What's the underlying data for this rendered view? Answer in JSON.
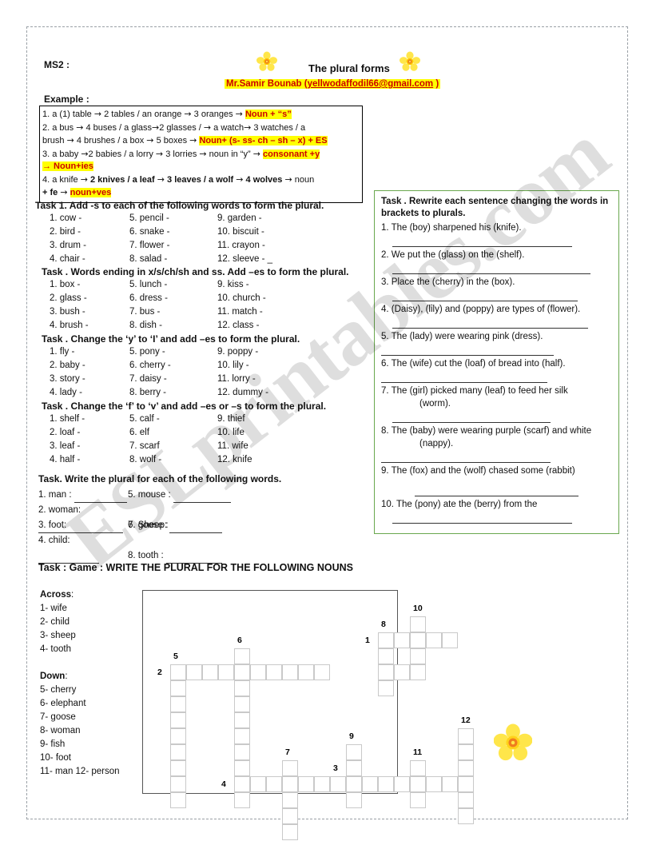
{
  "header": {
    "ms2": "MS2 :",
    "title": "The plural forms",
    "email_line": "Mr.Samir Bounab (yellwodaffodil66@gmail.com )",
    "email_prefix": "Mr.Samir Bounab (",
    "email_link": "yellwodaffodil66@gmail.com",
    "email_suffix": " )",
    "example_label": "Example :",
    "flower_left_icon": "daffodil-flower-icon",
    "flower_right_icon": "daffodil-flower-icon",
    "highlight_color": "#ffff00",
    "email_color": "#cc0000"
  },
  "example_box": {
    "lines": [
      {
        "parts": [
          {
            "t": "1.  a (1) table ",
            "s": "plain"
          },
          {
            "t": "→",
            "s": "arrow"
          },
          {
            "t": " 2 tables  / an orange ",
            "s": "plain"
          },
          {
            "t": "→",
            "s": "arrow"
          },
          {
            "t": " 3 oranges ",
            "s": "plain"
          },
          {
            "t": "→",
            "s": "arrow"
          },
          {
            "t": " ",
            "s": "plain"
          },
          {
            "t": "Noun + “s”",
            "s": "hl"
          }
        ]
      },
      {
        "parts": [
          {
            "t": "2. a bus ",
            "s": "plain"
          },
          {
            "t": "→",
            "s": "arrow"
          },
          {
            "t": " 4 buses / a glass",
            "s": "plain"
          },
          {
            "t": "→",
            "s": "arrow"
          },
          {
            "t": "2 glasses /  ",
            "s": "plain"
          },
          {
            "t": "→",
            "s": "arrow"
          },
          {
            "t": " a  watch",
            "s": "plain"
          },
          {
            "t": "→",
            "s": "arrow"
          },
          {
            "t": " 3 watches / a",
            "s": "plain"
          }
        ]
      },
      {
        "parts": [
          {
            "t": "brush ",
            "s": "plain"
          },
          {
            "t": "→",
            "s": "arrow"
          },
          {
            "t": " 4 brushes /  a box ",
            "s": "plain"
          },
          {
            "t": "→",
            "s": "arrow"
          },
          {
            "t": " 5 boxes ",
            "s": "plain"
          },
          {
            "t": "→",
            "s": "arrow"
          },
          {
            "t": " ",
            "s": "plain"
          },
          {
            "t": "Noun+ (s- ss- ch – sh – x) + ES",
            "s": "hl"
          }
        ]
      },
      {
        "parts": [
          {
            "t": "3. a baby ",
            "s": "plain"
          },
          {
            "t": "→",
            "s": "arrow"
          },
          {
            "t": "2 babies / a lorry ",
            "s": "plain"
          },
          {
            "t": "→",
            "s": "arrow"
          },
          {
            "t": " 3 lorries ",
            "s": "plain"
          },
          {
            "t": "→",
            "s": "arrow"
          },
          {
            "t": " noun in “y” ",
            "s": "plain"
          },
          {
            "t": "→",
            "s": "arrow"
          },
          {
            "t": " ",
            "s": "plain"
          },
          {
            "t": "consonant +y",
            "s": "hl"
          }
        ]
      },
      {
        "parts": [
          {
            "t": "→ Noun+ies",
            "s": "hl"
          }
        ]
      },
      {
        "parts": [
          {
            "t": "4. a knife ",
            "s": "plain"
          },
          {
            "t": "→",
            "s": "arrow"
          },
          {
            "t": "  2 knives / a leaf ",
            "s": "bold"
          },
          {
            "t": "→",
            "s": "arrow"
          },
          {
            "t": " 3 leaves / a wolf ",
            "s": "bold"
          },
          {
            "t": "→",
            "s": "arrow"
          },
          {
            "t": " 4 wolves ",
            "s": "bold"
          },
          {
            "t": "→",
            "s": "arrow"
          },
          {
            "t": "  noun",
            "s": "plain"
          }
        ]
      },
      {
        "parts": [
          {
            "t": "+ fe ",
            "s": "bold"
          },
          {
            "t": "→",
            "s": "arrow"
          },
          {
            "t": " ",
            "s": "plain"
          },
          {
            "t": "noun+ves",
            "s": "hl"
          }
        ]
      }
    ]
  },
  "tasks": [
    {
      "id": "task1",
      "heading": "Task 1.  Add  -s  to each of the following words to form the plural.",
      "rows": [
        [
          "1.  cow -",
          "5.  pencil -",
          "9.  garden -"
        ],
        [
          "2.  bird -",
          "6.  snake -",
          "10.  biscuit -"
        ],
        [
          "3.  drum -",
          "7.  flower -",
          "11.  crayon -"
        ],
        [
          "4.  chair -",
          "8.  salad -",
          "12.  sleeve -  _"
        ]
      ]
    },
    {
      "id": "task2",
      "heading": "Task .  Words ending in x/s/ch/sh and ss. Add –es to form the plural.",
      "rows": [
        [
          "1.  box -",
          "5.  lunch -",
          "9.  kiss      -"
        ],
        [
          "2.  glass -",
          "6.  dress -",
          "10.  church -"
        ],
        [
          "3.  bush -",
          "7.  bus -",
          "11.  match -"
        ],
        [
          "4.  brush -",
          "8.  dish  -",
          "12.  class   -"
        ]
      ]
    },
    {
      "id": "task3",
      "heading": "Task .  Change the ‘y’ to ‘I’ and add –es to form the plural.",
      "rows": [
        [
          "1.  fly   -",
          "5.  pony -",
          "9.  poppy -"
        ],
        [
          "2.  baby -",
          "6.  cherry -",
          "10.  lily        -"
        ],
        [
          "3.  story -",
          "7.  daisy  -",
          "11.  lorry   -"
        ],
        [
          "4.  lady  -",
          "8.  berry -",
          "12.  dummy -"
        ]
      ]
    },
    {
      "id": "task4",
      "heading": "Task .  Change the ‘f’ to ‘v’ and add –es or –s to form the plural.",
      "rows": [
        [
          "1.  shelf -",
          "5.  calf -",
          "9.  thief"
        ],
        [
          "2.  loaf  -",
          "6.  elf",
          "10.  life"
        ],
        [
          "3.  leaf   -",
          "7.  scarf",
          "11.  wife"
        ],
        [
          "4.  half   -",
          "8.  wolf -",
          "12.  knife"
        ]
      ]
    }
  ],
  "task_write_plural": {
    "heading": "Task. Write the plural for each of the following words.",
    "rows": [
      [
        "1.  man :",
        "5. mouse :"
      ],
      [
        "2.  woman:",
        "6.  goose :"
      ],
      [
        "3.  foot:",
        "7.  Sheep:"
      ],
      [
        "4.  child:",
        "8.  tooth :"
      ]
    ]
  },
  "green_box": {
    "heading": "Task . Rewrite each sentence changing the words in brackets to plurals.",
    "sentences": [
      {
        "n": "1.",
        "text": "The (boy) sharpened his (knife).",
        "indent": ""
      },
      {
        "n": "2.",
        "text": "We put the (glass) on the (shelf).",
        "indent": ""
      },
      {
        "n": "3.",
        "text": "Place the (cherry) in the (box).",
        "indent": ""
      },
      {
        "n": "4.",
        "text": "(Daisy), (lily) and (poppy) are types of (flower).",
        "indent": ""
      },
      {
        "n": "5.",
        "text": "The (lady) were wearing pink (dress).",
        "indent": ""
      },
      {
        "n": "6.",
        "text": "The (wife) cut the (loaf) of bread into (half).",
        "indent": ""
      },
      {
        "n": "7.",
        "text": "The (girl) picked many (leaf) to feed her silk",
        "indent": "(worm)."
      },
      {
        "n": "8.",
        "text": "The (baby) were wearing purple (scarf) and white",
        "indent": "(nappy)."
      },
      {
        "n": "9.",
        "text": "The (fox) and the (wolf) chased some (rabbit)",
        "indent": ""
      },
      {
        "n": "10.",
        "text": "The (pony) ate the (berry) from the",
        "indent": ""
      }
    ],
    "border_color": "#6aa84f"
  },
  "game": {
    "heading": "Task :  Game : WRITE THE PLURAL FOR THE FOLLOWING NOUNS",
    "across_title": "Across",
    "across_colon": ":",
    "across": [
      "1- wife",
      "2- child",
      "3- sheep",
      "4- tooth"
    ],
    "down_title": "Down",
    "down_colon": ":",
    "down": [
      "5- cherry",
      "6- elephant",
      "7- goose",
      "8- woman",
      "9- fish",
      "10- foot",
      "11- man    12- person"
    ],
    "crossword": {
      "cell_size": 20,
      "cells": [
        [
          16,
          1
        ],
        [
          16,
          2
        ],
        [
          16,
          3
        ],
        [
          14,
          2
        ],
        [
          15,
          2
        ],
        [
          16,
          2
        ],
        [
          17,
          2
        ],
        [
          18,
          2
        ],
        [
          14,
          3
        ],
        [
          14,
          4
        ],
        [
          16,
          3
        ],
        [
          16,
          4
        ],
        [
          5,
          3
        ],
        [
          1,
          4
        ],
        [
          2,
          4
        ],
        [
          3,
          4
        ],
        [
          4,
          4
        ],
        [
          5,
          4
        ],
        [
          6,
          4
        ],
        [
          7,
          4
        ],
        [
          8,
          4
        ],
        [
          9,
          4
        ],
        [
          10,
          4
        ],
        [
          14,
          4
        ],
        [
          15,
          4
        ],
        [
          1,
          5
        ],
        [
          5,
          5
        ],
        [
          14,
          5
        ],
        [
          1,
          6
        ],
        [
          5,
          6
        ],
        [
          1,
          7
        ],
        [
          5,
          7
        ],
        [
          1,
          8
        ],
        [
          5,
          8
        ],
        [
          19,
          8
        ],
        [
          1,
          9
        ],
        [
          5,
          9
        ],
        [
          12,
          9
        ],
        [
          19,
          9
        ],
        [
          1,
          10
        ],
        [
          5,
          10
        ],
        [
          8,
          10
        ],
        [
          12,
          10
        ],
        [
          16,
          10
        ],
        [
          19,
          10
        ],
        [
          1,
          11
        ],
        [
          5,
          11
        ],
        [
          6,
          11
        ],
        [
          7,
          11
        ],
        [
          8,
          11
        ],
        [
          9,
          11
        ],
        [
          10,
          11
        ],
        [
          11,
          11
        ],
        [
          12,
          11
        ],
        [
          13,
          11
        ],
        [
          14,
          11
        ],
        [
          15,
          11
        ],
        [
          16,
          11
        ],
        [
          17,
          11
        ],
        [
          18,
          11
        ],
        [
          19,
          11
        ],
        [
          1,
          12
        ],
        [
          5,
          12
        ],
        [
          8,
          12
        ],
        [
          12,
          12
        ],
        [
          16,
          12
        ],
        [
          19,
          12
        ],
        [
          8,
          13
        ],
        [
          19,
          13
        ],
        [
          8,
          14
        ]
      ],
      "numbers": [
        {
          "label": "1",
          "col": 13,
          "row": 2
        },
        {
          "label": "8",
          "col": 14,
          "row": 1
        },
        {
          "label": "10",
          "col": 16,
          "row": 0
        },
        {
          "label": "6",
          "col": 5,
          "row": 2
        },
        {
          "label": "5",
          "col": 1,
          "row": 3
        },
        {
          "label": "2",
          "col": 0,
          "row": 4
        },
        {
          "label": "12",
          "col": 19,
          "row": 7
        },
        {
          "label": "9",
          "col": 12,
          "row": 8
        },
        {
          "label": "11",
          "col": 16,
          "row": 9
        },
        {
          "label": "7",
          "col": 8,
          "row": 9
        },
        {
          "label": "3",
          "col": 11,
          "row": 10
        },
        {
          "label": "4",
          "col": 4,
          "row": 11
        }
      ]
    }
  },
  "decor": {
    "bottom_flower_icon": "daffodil-flower-icon",
    "flower_petal_color": "#ffe84d",
    "flower_center_color": "#f07c1e"
  },
  "watermark": {
    "text": "ESLprintables.com"
  }
}
